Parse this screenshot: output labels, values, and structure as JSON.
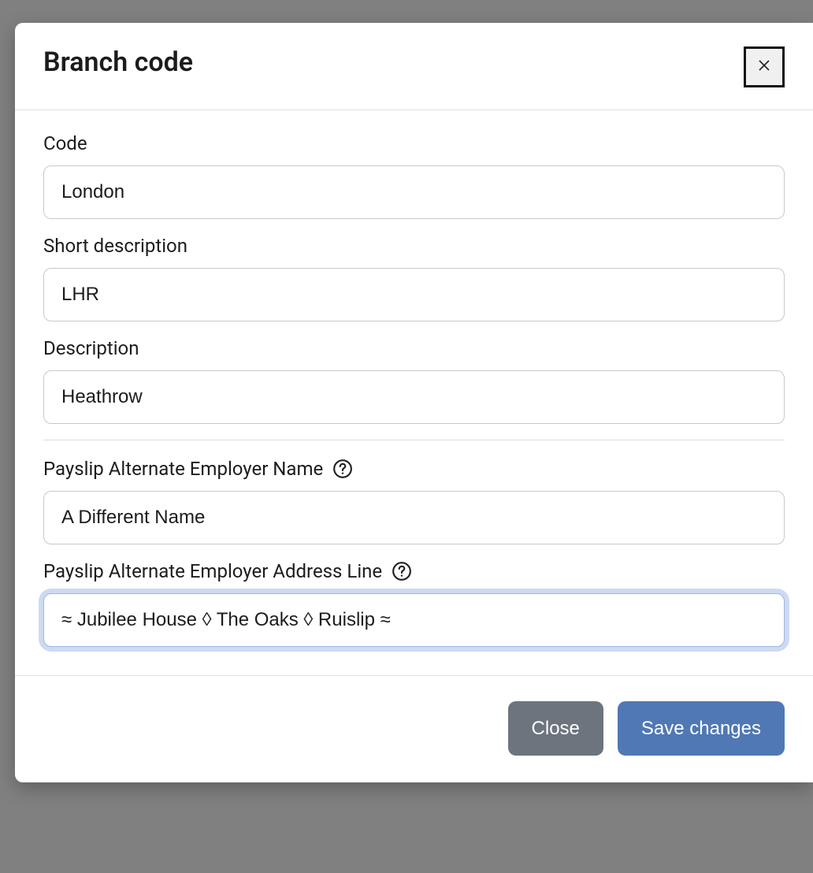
{
  "modal": {
    "title": "Branch code",
    "fields": {
      "code": {
        "label": "Code",
        "value": "London"
      },
      "short_description": {
        "label": "Short description",
        "value": "LHR"
      },
      "description": {
        "label": "Description",
        "value": "Heathrow"
      },
      "alt_employer_name": {
        "label": "Payslip Alternate Employer Name",
        "value": "A Different Name"
      },
      "alt_employer_address": {
        "label": "Payslip Alternate Employer Address Line",
        "value": "≈ Jubilee House ◊ The Oaks ◊ Ruislip ≈"
      }
    },
    "footer": {
      "close": "Close",
      "save": "Save changes"
    }
  }
}
